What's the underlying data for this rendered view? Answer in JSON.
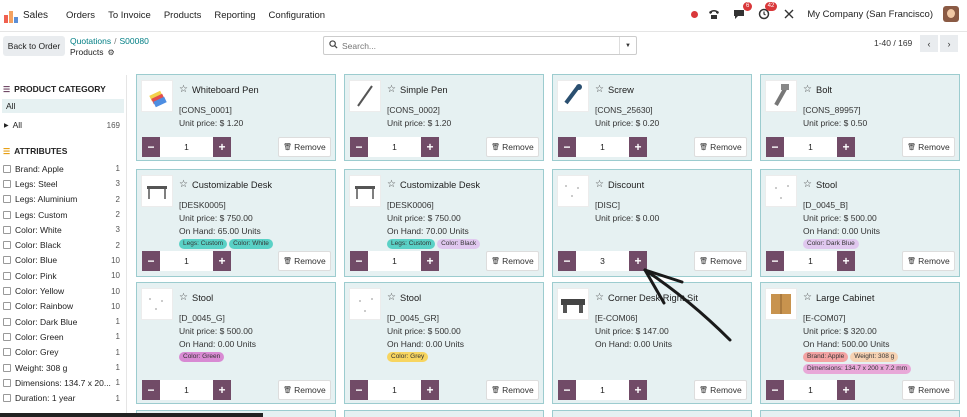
{
  "topbar": {
    "app_name": "Sales",
    "menu": [
      "Orders",
      "To Invoice",
      "Products",
      "Reporting",
      "Configuration"
    ],
    "messages_badge": "6",
    "activity_badge": "42",
    "company": "My Company (San Francisco)"
  },
  "controls": {
    "back_label": "Back to Order",
    "breadcrumb": [
      "Quotations",
      "S00080"
    ],
    "current": "Products",
    "search_placeholder": "Search...",
    "pager": "1-40 / 169"
  },
  "sidebar": {
    "category_title": "PRODUCT CATEGORY",
    "categories": [
      {
        "label": "All",
        "count": ""
      },
      {
        "label": "All",
        "count": "169"
      }
    ],
    "attributes_title": "ATTRIBUTES",
    "attributes": [
      {
        "label": "Brand: Apple",
        "count": "1"
      },
      {
        "label": "Legs: Steel",
        "count": "3"
      },
      {
        "label": "Legs: Aluminium",
        "count": "2"
      },
      {
        "label": "Legs: Custom",
        "count": "2"
      },
      {
        "label": "Color: White",
        "count": "3"
      },
      {
        "label": "Color: Black",
        "count": "2"
      },
      {
        "label": "Color: Blue",
        "count": "10"
      },
      {
        "label": "Color: Pink",
        "count": "10"
      },
      {
        "label": "Color: Yellow",
        "count": "10"
      },
      {
        "label": "Color: Rainbow",
        "count": "10"
      },
      {
        "label": "Color: Dark Blue",
        "count": "1"
      },
      {
        "label": "Color: Green",
        "count": "1"
      },
      {
        "label": "Color: Grey",
        "count": "1"
      },
      {
        "label": "Weight: 308 g",
        "count": "1"
      },
      {
        "label": "Dimensions: 134.7 x 20...",
        "count": "1"
      },
      {
        "label": "Duration: 1 year",
        "count": "1"
      }
    ]
  },
  "cards": [
    {
      "name": "Whiteboard Pen",
      "ref": "[CONS_0001]",
      "price": "Unit price: $ 1.20",
      "onhand": "",
      "qty": "1",
      "tags": []
    },
    {
      "name": "Simple Pen",
      "ref": "[CONS_0002]",
      "price": "Unit price: $ 1.20",
      "onhand": "",
      "qty": "1",
      "tags": []
    },
    {
      "name": "Screw",
      "ref": "[CONS_25630]",
      "price": "Unit price: $ 0.20",
      "onhand": "",
      "qty": "1",
      "tags": []
    },
    {
      "name": "Bolt",
      "ref": "[CONS_89957]",
      "price": "Unit price: $ 0.50",
      "onhand": "",
      "qty": "1",
      "tags": []
    },
    {
      "name": "Customizable Desk",
      "ref": "[DESK0005]",
      "price": "Unit price: $ 750.00",
      "onhand": "On Hand: 65.00 Units",
      "qty": "1",
      "tags": [
        {
          "label": "Legs: Custom",
          "bg": "#5ad1c6"
        },
        {
          "label": "Color: White",
          "bg": "#5ad1c6"
        }
      ]
    },
    {
      "name": "Customizable Desk",
      "ref": "[DESK0006]",
      "price": "Unit price: $ 750.00",
      "onhand": "On Hand: 70.00 Units",
      "qty": "1",
      "tags": [
        {
          "label": "Legs: Custom",
          "bg": "#5ad1c6"
        },
        {
          "label": "Color: Black",
          "bg": "#e0c8ef"
        }
      ]
    },
    {
      "name": "Discount",
      "ref": "[DISC]",
      "price": "Unit price: $ 0.00",
      "onhand": "",
      "qty": "3",
      "tags": []
    },
    {
      "name": "Stool",
      "ref": "[D_0045_B]",
      "price": "Unit price: $ 500.00",
      "onhand": "On Hand: 0.00 Units",
      "qty": "1",
      "tags": [
        {
          "label": "Color: Dark Blue",
          "bg": "#e0c8ef"
        }
      ]
    },
    {
      "name": "Stool",
      "ref": "[D_0045_G]",
      "price": "Unit price: $ 500.00",
      "onhand": "On Hand: 0.00 Units",
      "qty": "1",
      "tags": [
        {
          "label": "Color: Green",
          "bg": "#d88ad3"
        }
      ]
    },
    {
      "name": "Stool",
      "ref": "[D_0045_GR]",
      "price": "Unit price: $ 500.00",
      "onhand": "On Hand: 0.00 Units",
      "qty": "1",
      "tags": [
        {
          "label": "Color: Grey",
          "bg": "#f7d560"
        }
      ]
    },
    {
      "name": "Corner Desk Right Sit",
      "ref": "[E-COM06]",
      "price": "Unit price: $ 147.00",
      "onhand": "On Hand: 0.00 Units",
      "qty": "1",
      "tags": []
    },
    {
      "name": "Large Cabinet",
      "ref": "[E-COM07]",
      "price": "Unit price: $ 320.00",
      "onhand": "On Hand: 500.00 Units",
      "qty": "1",
      "tags": [
        {
          "label": "Brand: Apple",
          "bg": "#f3a3a3"
        },
        {
          "label": "Weight: 308 g",
          "bg": "#f6d2b3"
        },
        {
          "label": "Dimensions: 134.7 x 200 x 7.2 mm",
          "bg": "#e8a8d8"
        }
      ]
    }
  ],
  "remove_label": "Remove",
  "colors": {
    "accent": "#714b67",
    "card_bg": "#e6f1f2",
    "link": "#017e84"
  }
}
